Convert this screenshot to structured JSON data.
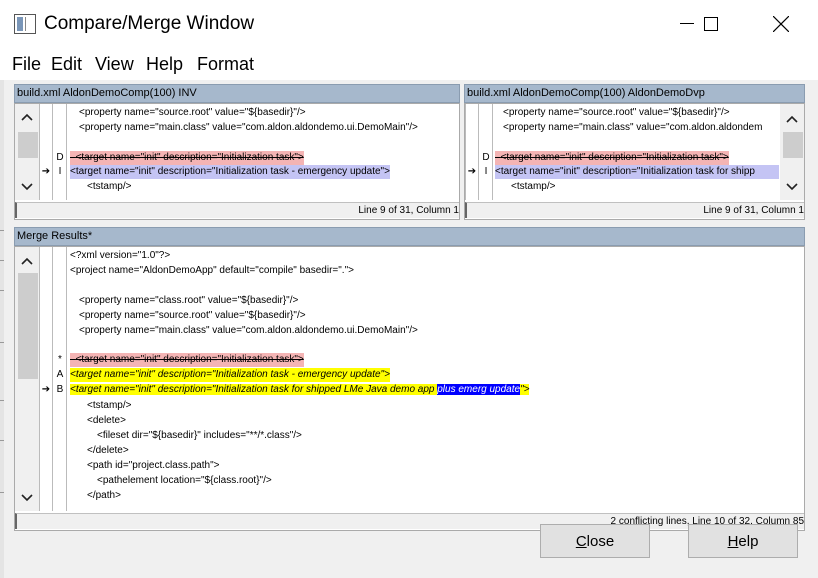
{
  "window": {
    "title": "Compare/Merge Window"
  },
  "menu": [
    "File",
    "Edit",
    "View",
    "Help",
    "Format"
  ],
  "left_pane": {
    "header": "build.xml AldonDemoComp(100) INV",
    "lines": [
      "<property name=\"source.root\" value=\"${basedir}\"/>",
      "<property name=\"main.class\" value=\"com.aldon.aldondemo.ui.DemoMain\"/>",
      "",
      "<target name=\"init\" description=\"Initialization task\">",
      "<target name=\"init\" description=\"Initialization task - emergency update\">",
      "<tstamp/>"
    ],
    "markers": [
      "",
      "",
      "",
      "D",
      "I",
      ""
    ],
    "status": "Line 9 of 31, Column 1"
  },
  "right_pane": {
    "header": "build.xml AldonDemoComp(100) AldonDemoDvp",
    "lines": [
      "<property name=\"source.root\" value=\"${basedir}\"/>",
      "<property name=\"main.class\" value=\"com.aldon.aldondem",
      "",
      "<target name=\"init\" description=\"Initialization task\">",
      "<target name=\"init\" description=\"Initialization task for shipp",
      "<tstamp/>"
    ],
    "markers": [
      "",
      "",
      "",
      "D",
      "I",
      ""
    ],
    "status": "Line 9 of 31, Column 1"
  },
  "merge": {
    "header": "Merge Results*",
    "lines": [
      "<?xml version=\"1.0\"?>",
      "<project name=\"AldonDemoApp\" default=\"compile\" basedir=\".\">",
      "",
      "<property name=\"class.root\" value=\"${basedir}\"/>",
      "<property name=\"source.root\" value=\"${basedir}\"/>",
      "<property name=\"main.class\" value=\"com.aldon.aldondemo.ui.DemoMain\"/>",
      "",
      "<target name=\"init\" description=\"Initialization task\">",
      "<target name=\"init\" description=\"Initialization task - emergency update\">",
      "<target name=\"init\" description=\"Initialization task for shipped LMe Java demo app ",
      "<tstamp/>",
      "<delete>",
      "<fileset dir=\"${basedir}\" includes=\"**/*.class\"/>",
      "</delete>",
      "<path id=\"project.class.path\">",
      "<pathelement location=\"${class.root}\"/>",
      "</path>"
    ],
    "highlight_mid": "plus emerg update",
    "highlight_end": "\">",
    "markers": [
      "",
      "",
      "",
      "",
      "",
      "",
      "",
      "*",
      "A",
      "B",
      "",
      "",
      "",
      "",
      "",
      "",
      ""
    ],
    "status": "2 conflicting lines, Line 10 of 32, Column 85"
  },
  "buttons": {
    "close_prefix": "C",
    "close_rest": "lose",
    "help_prefix": "H",
    "help_rest": "elp"
  },
  "colors": {
    "deleted": "#f4b4b4",
    "changed": "#c4c4f4",
    "conflict": "#ffff00",
    "highlight": "#0000ff",
    "pane_header": "#a6b8cc"
  }
}
